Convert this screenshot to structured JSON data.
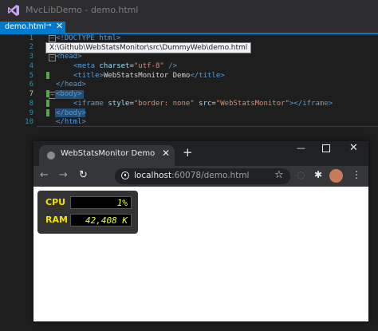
{
  "ide": {
    "title": "MvcLibDemo - demo.html",
    "tab": {
      "label": "demo.html",
      "pin": "⊸",
      "close": "✕"
    },
    "tooltip": "X:\\Github\\WebStatsMonitor\\src\\DummyWeb\\demo.html",
    "line_numbers": [
      "1",
      "2",
      "3",
      "4",
      "5",
      "6",
      "7",
      "8",
      "9",
      "10"
    ],
    "code": {
      "l1": {
        "open": "<",
        "doctype": "!DOCTYPE",
        "html": "html",
        "close": ">"
      },
      "l3": {
        "tag": "<head>"
      },
      "l4": {
        "open": "<meta ",
        "attr": "charset",
        "eq": "=",
        "val": "\"utf-8\"",
        "close": " />"
      },
      "l5": {
        "open": "<title>",
        "text": "WebStatsMonitor Demo",
        "close": "</title>"
      },
      "l6": {
        "tag": "</head>"
      },
      "l7": {
        "tag": "<body>"
      },
      "l8": {
        "open": "<iframe ",
        "a1": "style",
        "eq1": "=",
        "v1": "\"border: none\"",
        "a2": " src",
        "eq2": "=",
        "v2": "\"WebStatsMonitor\"",
        "close": "></iframe>"
      },
      "l9": {
        "tag": "</body>"
      },
      "l10": {
        "tag": "</html>"
      }
    }
  },
  "browser": {
    "tab_title": "WebStatsMonitor Demo",
    "tab_close": "✕",
    "new_tab": "+",
    "url_host": "localhost",
    "url_rest": ":60078/demo.html",
    "controls": {
      "min": "—",
      "close": "✕"
    },
    "nav": {
      "back": "←",
      "forward": "→",
      "reload": "↻",
      "star": "☆",
      "extensions": "✱",
      "menu": "⋮",
      "account": "◌"
    }
  },
  "stats": {
    "cpu_label": "CPU",
    "cpu_value": "1%",
    "ram_label": "RAM",
    "ram_value": "42,408 K"
  },
  "colors": {
    "vs_accent": "#007acc",
    "widget_label": "#f2e100",
    "widget_value": "#e8ff3a"
  }
}
